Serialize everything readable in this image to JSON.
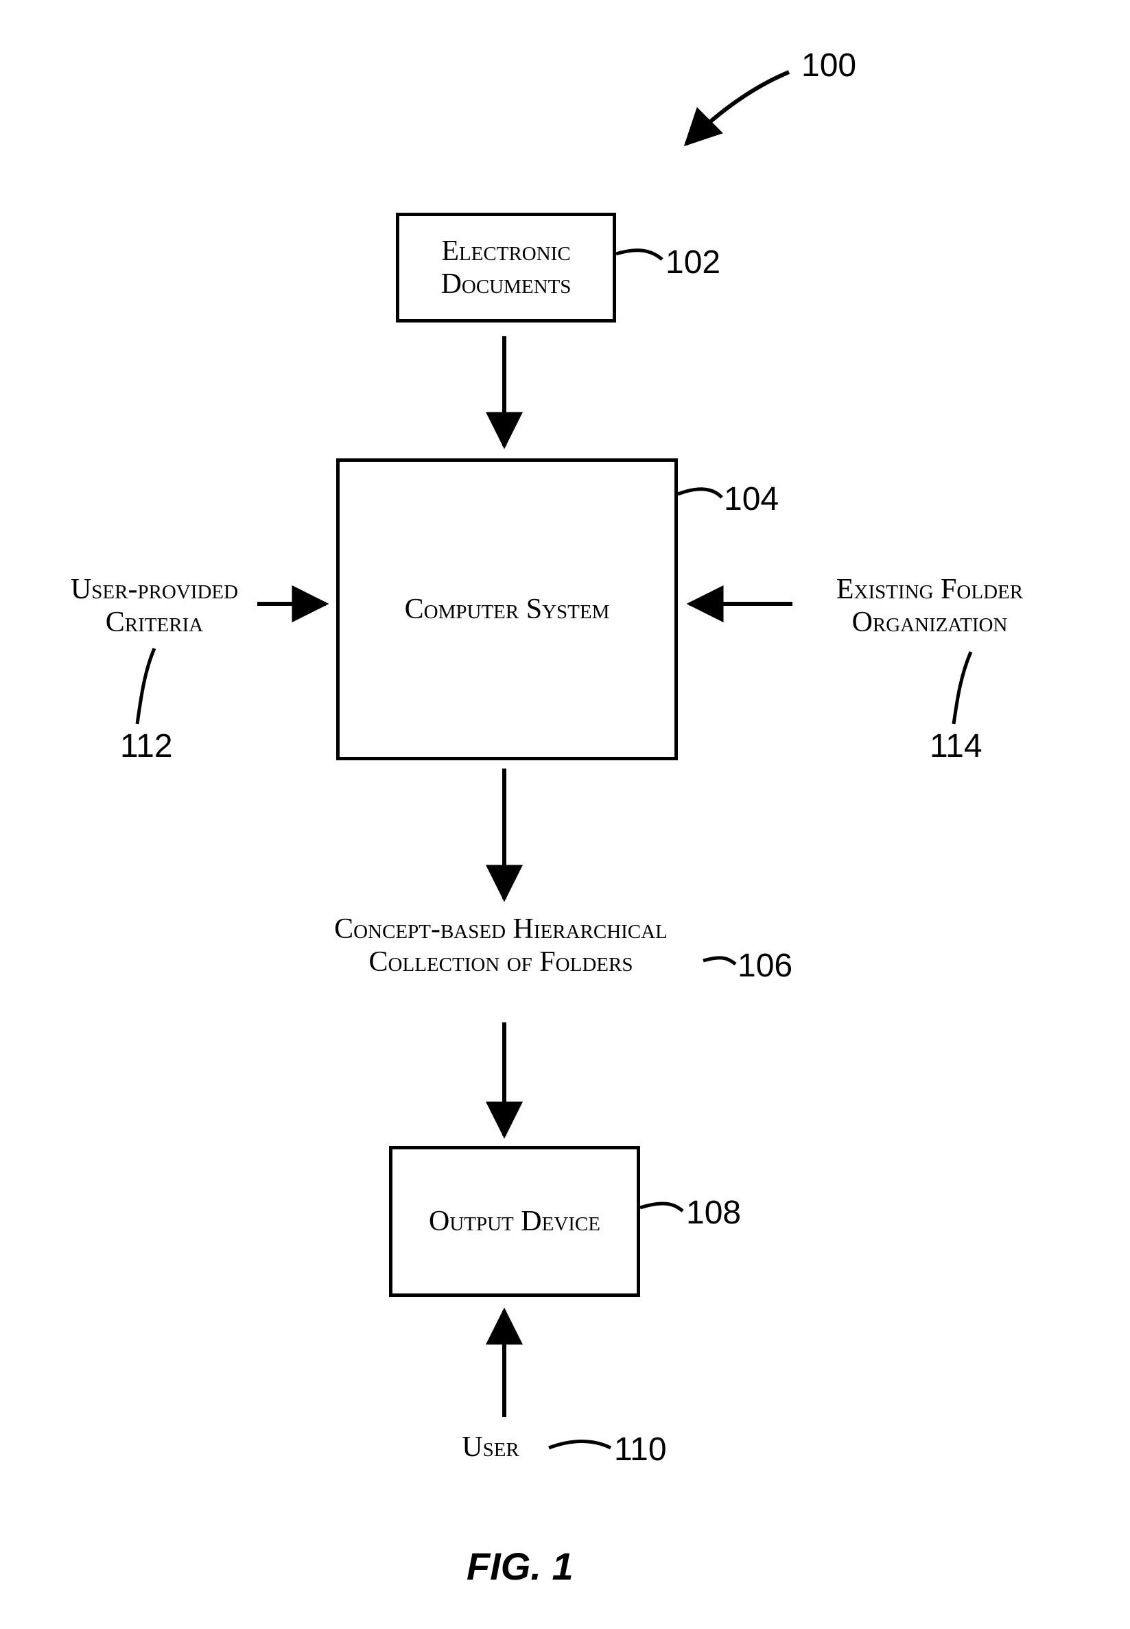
{
  "figure": {
    "caption": "FIG. 1",
    "ref_100": "100",
    "nodes": {
      "electronic_documents": {
        "text": "Electronic Documents",
        "ref": "102"
      },
      "computer_system": {
        "text": "Computer System",
        "ref": "104"
      },
      "user_provided_criteria": {
        "text": "User-provided Criteria",
        "ref": "112"
      },
      "existing_folder_organization": {
        "text": "Existing Folder Organization",
        "ref": "114"
      },
      "concept_hierarchy": {
        "text": "Concept-based Hierarchical Collection of Folders",
        "ref": "106"
      },
      "output_device": {
        "text": "Output Device",
        "ref": "108"
      },
      "user": {
        "text": "User",
        "ref": "110"
      }
    }
  }
}
